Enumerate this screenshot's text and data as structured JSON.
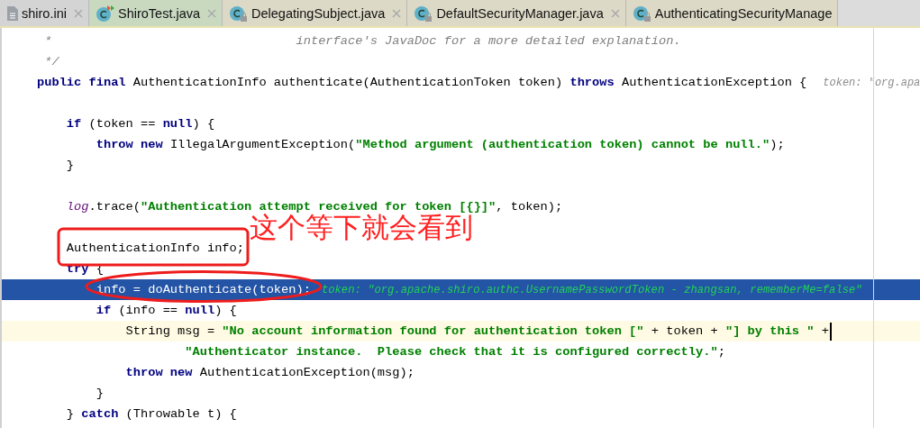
{
  "tabs": [
    {
      "label": "shiro.ini",
      "kind": "text-file",
      "color": "#d4d4d4",
      "closable": true
    },
    {
      "label": "ShiroTest.java",
      "kind": "test-class",
      "color": "#c8d9c0",
      "closable": true
    },
    {
      "label": "DelegatingSubject.java",
      "kind": "library-class",
      "color": "#dcd9c6",
      "closable": true
    },
    {
      "label": "DefaultSecurityManager.java",
      "kind": "library-class",
      "color": "#dcd9c6",
      "closable": true
    },
    {
      "label": "AuthenticatingSecurityManage",
      "kind": "library-class",
      "color": "#dcd9c6",
      "closable": false
    }
  ],
  "code_lines": [
    {
      "kind": "code",
      "tokens": [
        {
          "kind": "comment",
          "text": " *                                 interface's JavaDoc for a more detailed explanation."
        }
      ]
    },
    {
      "kind": "code",
      "tokens": [
        {
          "kind": "comment",
          "text": " */"
        }
      ]
    },
    {
      "kind": "code",
      "tokens": [
        {
          "kind": "kw",
          "text": "public final"
        },
        {
          "kind": "plain",
          "text": " AuthenticationInfo authenticate(AuthenticationToken token) "
        },
        {
          "kind": "kw",
          "text": "throws"
        },
        {
          "kind": "plain",
          "text": " AuthenticationException {"
        },
        {
          "kind": "hint",
          "text": "token: \"org.apa"
        }
      ]
    },
    {
      "kind": "blank"
    },
    {
      "kind": "code",
      "tokens": [
        {
          "kind": "kw",
          "text": "    if"
        },
        {
          "kind": "plain",
          "text": " (token == "
        },
        {
          "kind": "kw",
          "text": "null"
        },
        {
          "kind": "plain",
          "text": ") {"
        }
      ]
    },
    {
      "kind": "code",
      "tokens": [
        {
          "kind": "kw",
          "text": "        throw new"
        },
        {
          "kind": "plain",
          "text": " IllegalArgumentException("
        },
        {
          "kind": "str",
          "text": "\"Method argument (authentication token) cannot be null.\""
        },
        {
          "kind": "plain",
          "text": ");"
        }
      ]
    },
    {
      "kind": "code",
      "tokens": [
        {
          "kind": "plain",
          "text": "    }"
        }
      ]
    },
    {
      "kind": "blank"
    },
    {
      "kind": "code",
      "tokens": [
        {
          "kind": "field",
          "text": "    log"
        },
        {
          "kind": "plain",
          "text": ".trace("
        },
        {
          "kind": "str",
          "text": "\"Authentication attempt received for token [{}]\""
        },
        {
          "kind": "plain",
          "text": ", token);"
        }
      ]
    },
    {
      "kind": "blank"
    },
    {
      "kind": "code",
      "tokens": [
        {
          "kind": "plain",
          "text": "    AuthenticationInfo info;"
        }
      ]
    },
    {
      "kind": "code",
      "tokens": [
        {
          "kind": "kw",
          "text": "    try"
        },
        {
          "kind": "plain",
          "text": " {"
        }
      ]
    },
    {
      "kind": "execution",
      "tokens": [
        {
          "kind": "plain",
          "text": "        info = doAuthenticate(token);"
        },
        {
          "kind": "hint",
          "text": "token: \"org.apache.shiro.authc.UsernamePasswordToken - zhangsan, rememberMe=false\""
        }
      ]
    },
    {
      "kind": "code",
      "tokens": [
        {
          "kind": "kw",
          "text": "        if"
        },
        {
          "kind": "plain",
          "text": " (info == "
        },
        {
          "kind": "kw",
          "text": "null"
        },
        {
          "kind": "plain",
          "text": ") {"
        }
      ]
    },
    {
      "kind": "caret",
      "tokens": [
        {
          "kind": "plain",
          "text": "            String msg = "
        },
        {
          "kind": "str",
          "text": "\"No account information found for authentication token [\""
        },
        {
          "kind": "plain",
          "text": " + token + "
        },
        {
          "kind": "str",
          "text": "\"] by this \""
        },
        {
          "kind": "plain",
          "text": " +"
        }
      ]
    },
    {
      "kind": "code",
      "tokens": [
        {
          "kind": "str",
          "text": "                    \"Authenticator instance.  Please check that it is configured correctly.\""
        },
        {
          "kind": "plain",
          "text": ";"
        }
      ]
    },
    {
      "kind": "code",
      "tokens": [
        {
          "kind": "kw",
          "text": "            throw new"
        },
        {
          "kind": "plain",
          "text": " AuthenticationException(msg);"
        }
      ]
    },
    {
      "kind": "code",
      "tokens": [
        {
          "kind": "plain",
          "text": "        }"
        }
      ]
    },
    {
      "kind": "code",
      "tokens": [
        {
          "kind": "plain",
          "text": "    } "
        },
        {
          "kind": "kw",
          "text": "catch"
        },
        {
          "kind": "plain",
          "text": " (Throwable t) {"
        }
      ]
    }
  ],
  "annotation": {
    "note": "这个等下就会看到"
  }
}
